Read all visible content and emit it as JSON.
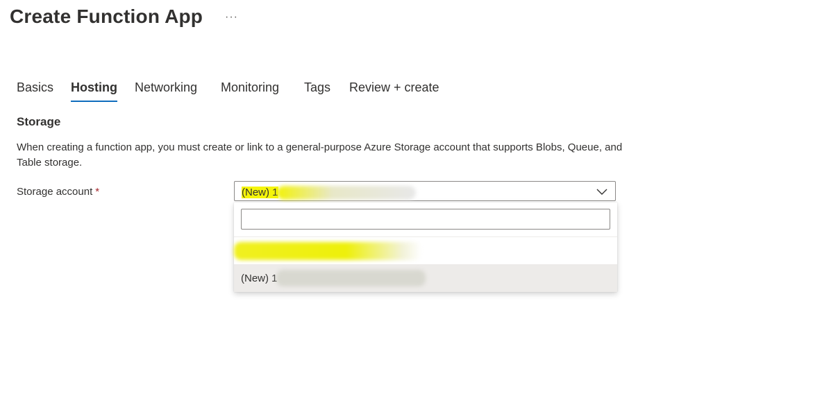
{
  "header": {
    "title": "Create Function App",
    "more_label": "···"
  },
  "tabs": [
    {
      "label": "Basics",
      "active": false
    },
    {
      "label": "Hosting",
      "active": true
    },
    {
      "label": "Networking",
      "active": false
    },
    {
      "label": "Monitoring",
      "active": false
    },
    {
      "label": "Tags",
      "active": false
    },
    {
      "label": "Review + create",
      "active": false
    }
  ],
  "storage": {
    "section_title": "Storage",
    "description": "When creating a function app, you must create or link to a general-purpose Azure Storage account that supports Blobs, Queue, and Table storage.",
    "label": "Storage account",
    "required_mark": "*",
    "selected_prefix": "(New) 1",
    "search_value": "",
    "options": [
      {
        "label": ""
      },
      {
        "label": "(New) 1"
      }
    ]
  },
  "colors": {
    "accent": "#0f6cbd",
    "required": "#a4262c",
    "highlight": "#f2f20a"
  }
}
